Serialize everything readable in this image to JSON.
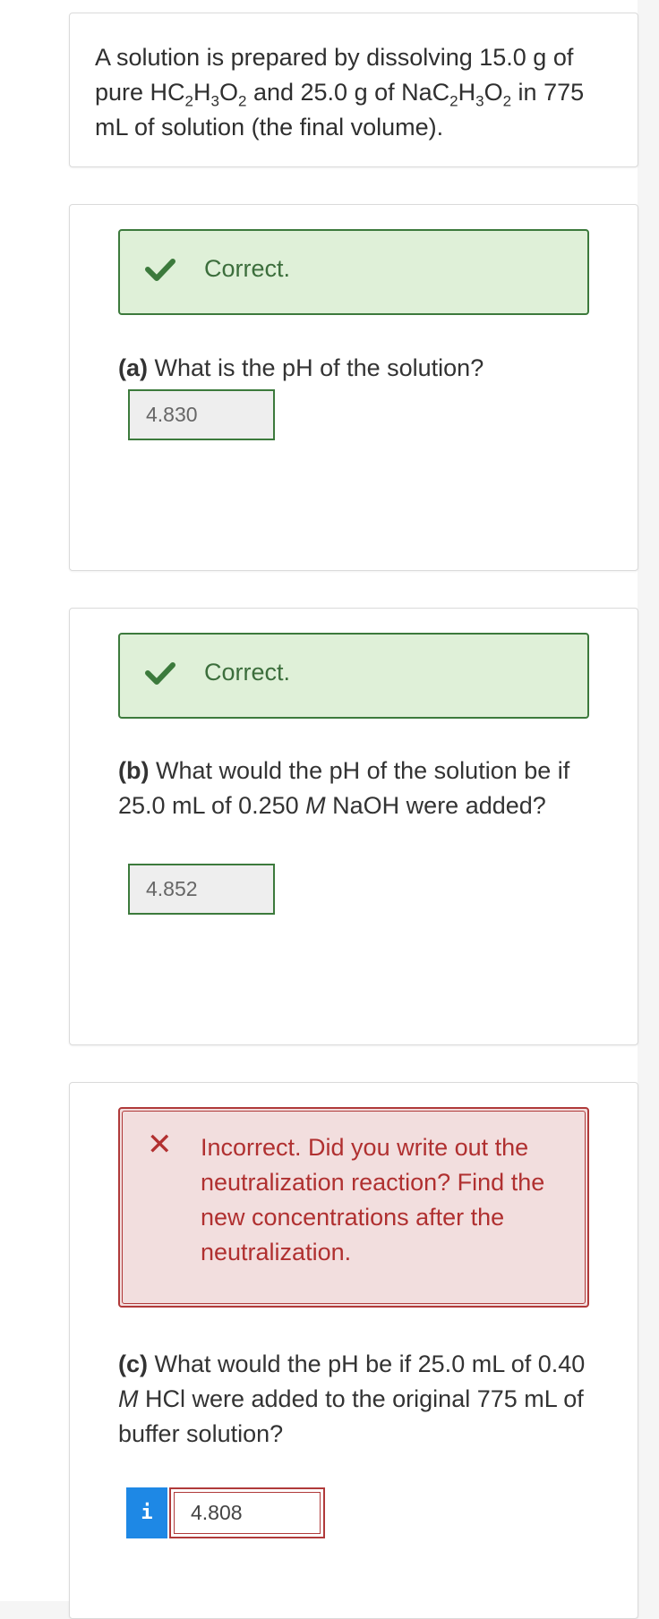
{
  "intro": {
    "text_parts": [
      "A solution is prepared by dissolving 15.0 g of pure HC",
      "2",
      "H",
      "3",
      "O",
      "2",
      " and 25.0 g of NaC",
      "2",
      "H",
      "3",
      "O",
      "2",
      " in 775 mL of solution (the final volume)."
    ]
  },
  "part_a": {
    "feedback": "Correct.",
    "label": "(a)",
    "question": " What is the pH of the solution?",
    "answer": "4.830"
  },
  "part_b": {
    "feedback": "Correct.",
    "label": "(b)",
    "question_1": " What would the pH of the solution be if 25.0 mL of 0.250 ",
    "question_m": "M",
    "question_2": " NaOH were added?",
    "answer": "4.852"
  },
  "part_c": {
    "feedback": "Incorrect. Did you write out the neutralization reaction? Find the new concentrations after the neutralization.",
    "label": "(c)",
    "question_1": " What would the pH be if 25.0 mL of 0.40 ",
    "question_m": "M",
    "question_2": " HCl were added to the original 775 mL of buffer solution?",
    "info_label": "i",
    "answer": "4.808"
  },
  "icons": {
    "correct": "checkmark-icon",
    "incorrect": "x-mark-icon",
    "info": "info-icon"
  },
  "colors": {
    "success_bg": "#dff0d8",
    "success_border": "#3c7a3c",
    "error_bg": "#f2dede",
    "error_border": "#b03a3a",
    "info_button": "#1e88e5"
  }
}
